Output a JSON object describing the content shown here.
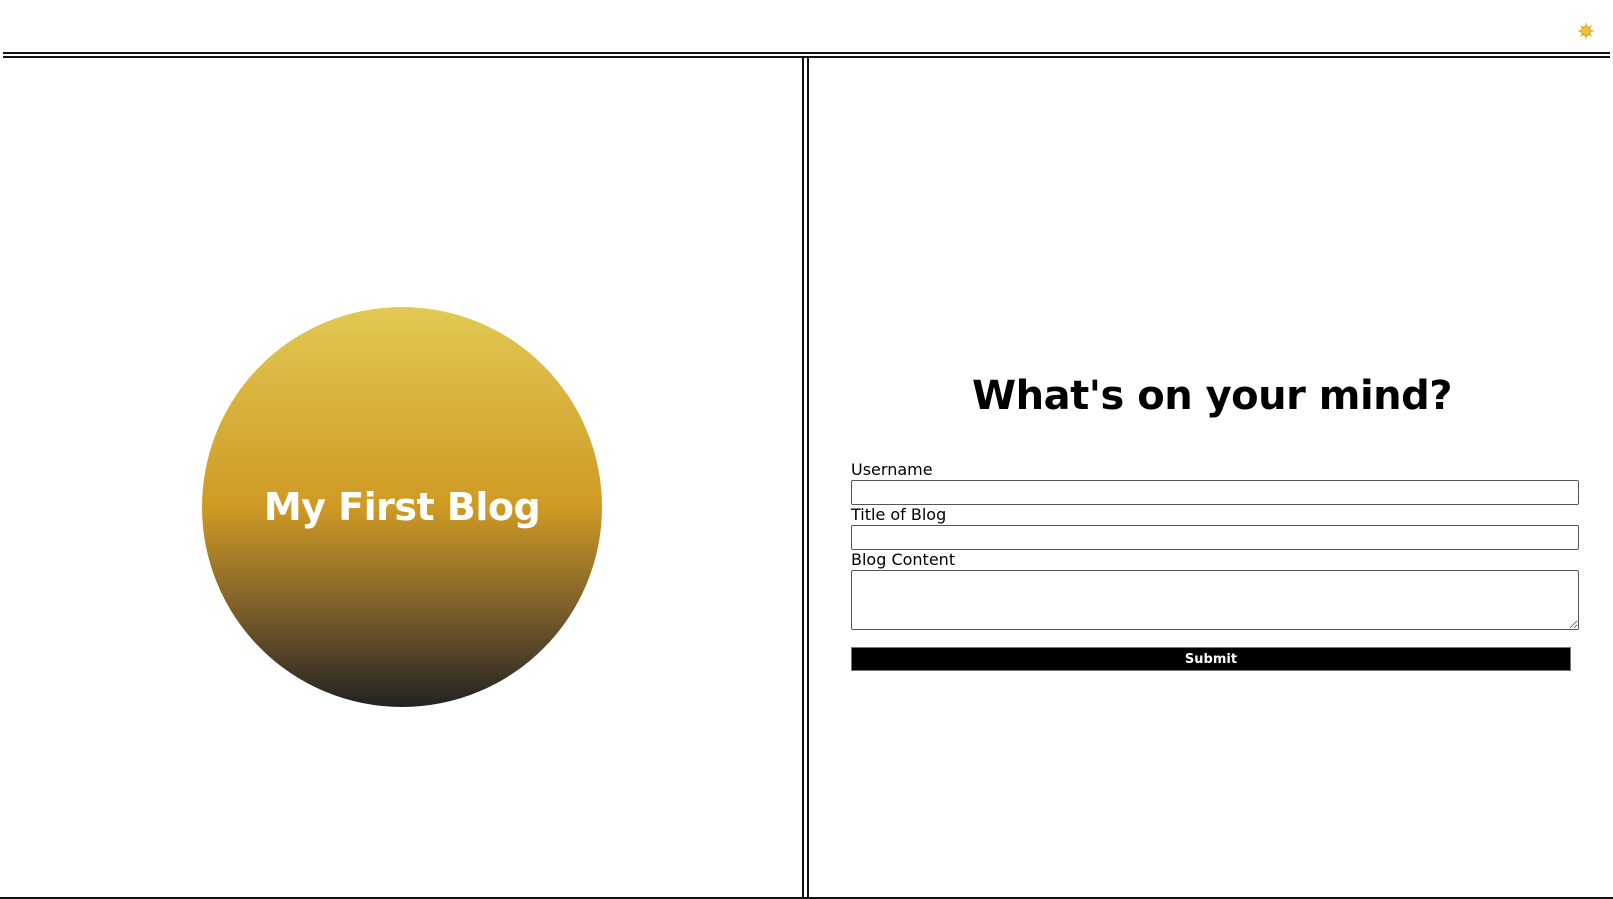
{
  "header": {
    "theme_toggle_icon": "sun-icon",
    "theme_toggle_color": "#e0b52a"
  },
  "hero": {
    "title": "My First Blog",
    "gradient_colors": [
      "#e2c954",
      "#cf9a24",
      "#222222"
    ]
  },
  "form": {
    "heading": "What's on your mind?",
    "username_label": "Username",
    "username_value": "",
    "title_label": "Title of Blog",
    "title_value": "",
    "content_label": "Blog Content",
    "content_value": "",
    "submit_label": "Submit"
  }
}
